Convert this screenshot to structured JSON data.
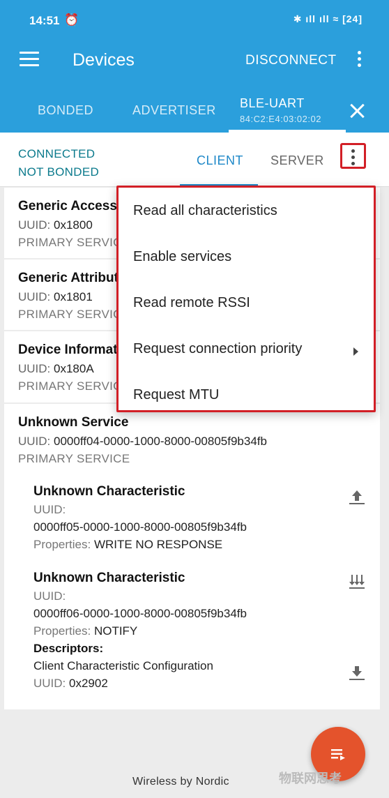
{
  "status_bar": {
    "time": "14:51",
    "alarm_icon": "⏰",
    "system_icons": "✱ ıll ıll ≈ [24]"
  },
  "app_bar": {
    "title": "Devices",
    "disconnect_label": "DISCONNECT"
  },
  "device_tabs": {
    "bonded": "BONDED",
    "advertiser": "ADVERTISER",
    "active_name": "BLE-UART",
    "active_address": "84:C2:E4:03:02:02"
  },
  "connection": {
    "state": "CONNECTED",
    "bond_state": "NOT BONDED",
    "tab_client": "CLIENT",
    "tab_server": "SERVER"
  },
  "services": [
    {
      "name": "Generic Access",
      "uuid_label": "UUID:",
      "uuid": "0x1800",
      "type": "PRIMARY SERVICE"
    },
    {
      "name": "Generic Attribute",
      "uuid_label": "UUID:",
      "uuid": "0x1801",
      "type": "PRIMARY SERVICE"
    },
    {
      "name": "Device Information",
      "uuid_label": "UUID:",
      "uuid": "0x180A",
      "type": "PRIMARY SERVICE"
    },
    {
      "name": "Unknown Service",
      "uuid_label": "UUID:",
      "uuid": "0000ff04-0000-1000-8000-00805f9b34fb",
      "type": "PRIMARY SERVICE"
    }
  ],
  "characteristics": [
    {
      "name": "Unknown Characteristic",
      "uuid_label": "UUID:",
      "uuid": "0000ff05-0000-1000-8000-00805f9b34fb",
      "properties_label": "Properties:",
      "properties": "WRITE NO RESPONSE"
    },
    {
      "name": "Unknown Characteristic",
      "uuid_label": "UUID:",
      "uuid": "0000ff06-0000-1000-8000-00805f9b34fb",
      "properties_label": "Properties:",
      "properties": "NOTIFY",
      "descriptors_label": "Descriptors:",
      "descriptor_name": "Client Characteristic Configuration",
      "descriptor_uuid_label": "UUID:",
      "descriptor_uuid": "0x2902"
    }
  ],
  "popup_menu": {
    "items": [
      "Read all characteristics",
      "Enable services",
      "Read remote RSSI",
      "Request connection priority",
      "Request MTU"
    ]
  },
  "footer": "Wireless by Nordic",
  "watermark": "物联网思考",
  "colors": {
    "app_bar": "#2b9fdc",
    "accent": "#1e88c8",
    "connected": "#0b7a8c",
    "fab": "#e4532c",
    "highlight": "#d21f26"
  }
}
